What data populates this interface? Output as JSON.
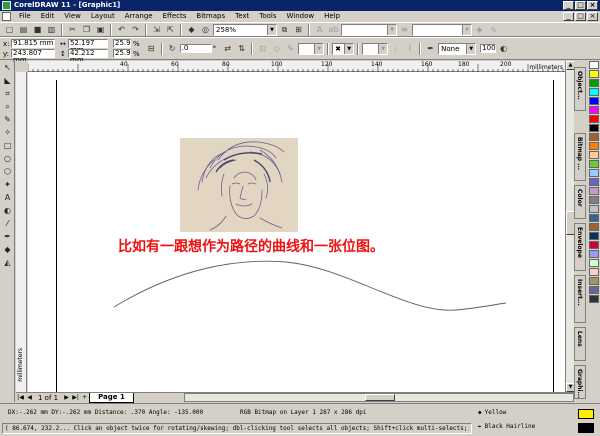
{
  "window": {
    "title": "CorelDRAW 11 - [Graphic1]",
    "min": "_",
    "max": "□",
    "close": "×"
  },
  "menubar": {
    "items": [
      "File",
      "Edit",
      "View",
      "Layout",
      "Arrange",
      "Effects",
      "Bitmaps",
      "Text",
      "Tools",
      "Window",
      "Help"
    ]
  },
  "toolbar": {
    "zoom": "258%"
  },
  "propbar": {
    "x": "91.815 mm",
    "y": "243.807 mm",
    "w": "52.197 mm",
    "h": "42.212 mm",
    "scale_w": "25.9",
    "scale_h": "25.9",
    "angle": ".0",
    "outline": "None",
    "percent": "100"
  },
  "ruler": {
    "h_ticks": [
      "40",
      "60",
      "80",
      "100",
      "120",
      "140",
      "160",
      "180",
      "200"
    ],
    "unit": "millimeters"
  },
  "canvas": {
    "caption": "比如有一跟想作为路径的曲线和一张位图。"
  },
  "pagebar": {
    "count": "1 of 1",
    "page_label": "Page 1"
  },
  "status": {
    "line1": "DX:-.262 mm DY:-.262 mm Distance: .370 Angle: -135.000",
    "bitmap_info": "RGB Bitmap on Layer 1 287 x 286 dpi",
    "line2": "( 86.674, 232.2... Click an object twice for rotating/skewing; dbl-clicking tool selects all objects; Shift+click multi-selects; Al...",
    "fill_label": "Yellow",
    "outline_label": "Black  Hairline"
  },
  "dockers": [
    "Object...",
    "Bitmap ...",
    "Color",
    "Envelope",
    "Insert...",
    "Lens",
    "Graphi..."
  ],
  "colors": {
    "fill": "#ffee00",
    "outline": "#000000",
    "palette": [
      "#ffffff",
      "#ffff00",
      "#00a000",
      "#00ffff",
      "#0000ff",
      "#ff00ff",
      "#ff0000",
      "#000000",
      "#a06030",
      "#ff8000",
      "#ffcc99",
      "#66cc33",
      "#99ccff",
      "#6666cc",
      "#cc99cc",
      "#808080",
      "#c0c0c0",
      "#336699",
      "#996633",
      "#003366",
      "#cc0033",
      "#9999ff",
      "#ccffcc",
      "#ffcccc",
      "#999966",
      "#666699",
      "#333333"
    ]
  }
}
